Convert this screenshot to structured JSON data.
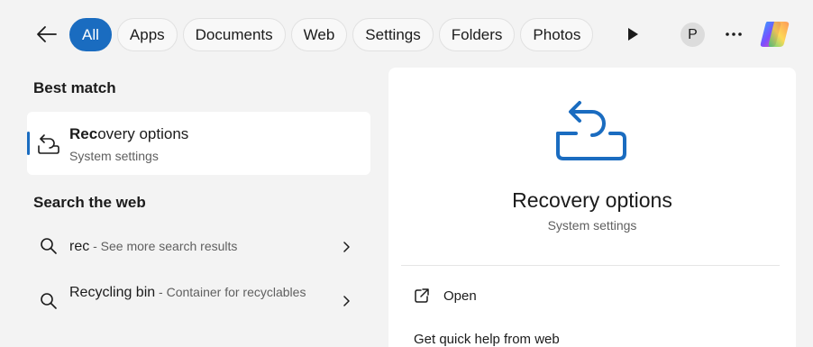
{
  "filters": {
    "chips": [
      {
        "label": "All",
        "active": true
      },
      {
        "label": "Apps",
        "active": false
      },
      {
        "label": "Documents",
        "active": false
      },
      {
        "label": "Web",
        "active": false
      },
      {
        "label": "Settings",
        "active": false
      },
      {
        "label": "Folders",
        "active": false
      },
      {
        "label": "Photos",
        "active": false
      }
    ],
    "avatar_initial": "P",
    "more_label": "···"
  },
  "best_match": {
    "heading": "Best match",
    "title_bold": "Rec",
    "title_rest": "overy options",
    "subtitle": "System settings"
  },
  "web": {
    "heading": "Search the web",
    "items": [
      {
        "query": "rec",
        "hint": " - See more search results"
      },
      {
        "query": "Recycling bin",
        "hint": " - Container for recyclables"
      }
    ]
  },
  "detail": {
    "title": "Recovery options",
    "subtitle": "System settings",
    "actions": [
      {
        "label": "Open"
      },
      {
        "label": "Get quick help from web"
      }
    ]
  },
  "colors": {
    "accent": "#1a6cc0",
    "background": "#f3f3f3",
    "card": "#ffffff",
    "secondary_text": "#5f5f5f"
  },
  "icons": {
    "back": "arrow-left-icon",
    "play": "play-icon",
    "more": "more-icon",
    "copilot": "copilot-icon",
    "recovery": "recovery-icon",
    "search": "search-icon",
    "chevron": "chevron-right-icon",
    "open": "open-external-icon"
  }
}
